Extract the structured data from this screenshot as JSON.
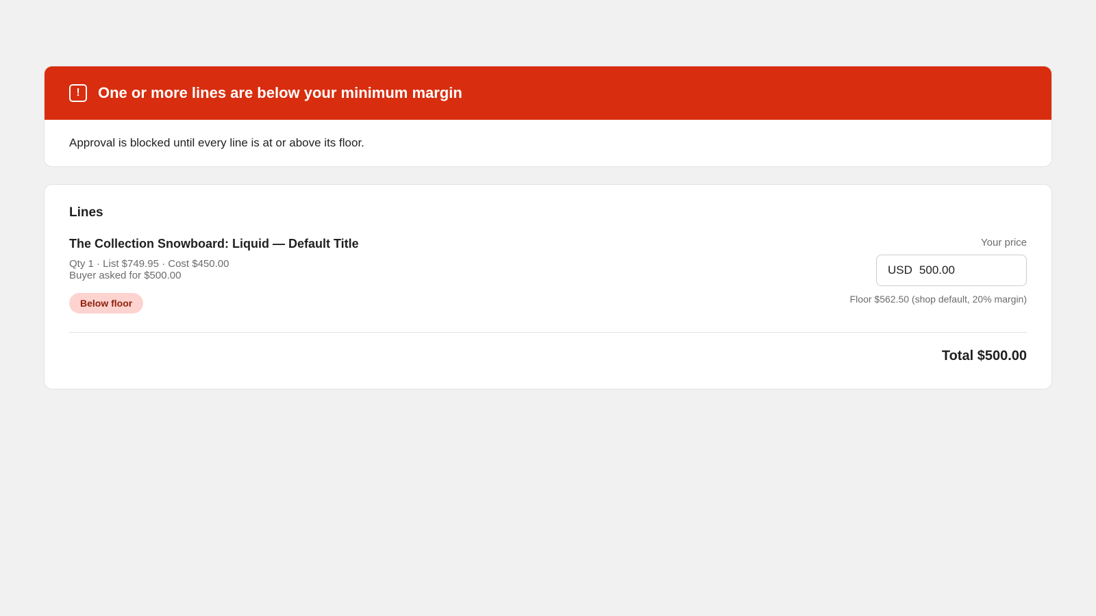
{
  "banner": {
    "icon": "exclamation-square-icon",
    "title": "One or more lines are below your minimum margin",
    "body": "Approval is blocked until every line is at or above its floor.",
    "color": "#d82d0e"
  },
  "lines": {
    "heading": "Lines",
    "items": [
      {
        "title": "The Collection Snowboard: Liquid — Default Title",
        "meta": "Qty 1 · List $749.95 · Cost $450.00",
        "buyer_ask": "Buyer asked for $500.00",
        "badge": "Below floor",
        "price_label": "Your price",
        "currency": "USD",
        "price_value": "500.00",
        "floor_note": "Floor $562.50 (shop default, 20% margin)"
      }
    ],
    "total": "Total $500.00"
  },
  "colors": {
    "badge_bg": "#fdd3d0",
    "badge_text": "#8e1f0b"
  }
}
